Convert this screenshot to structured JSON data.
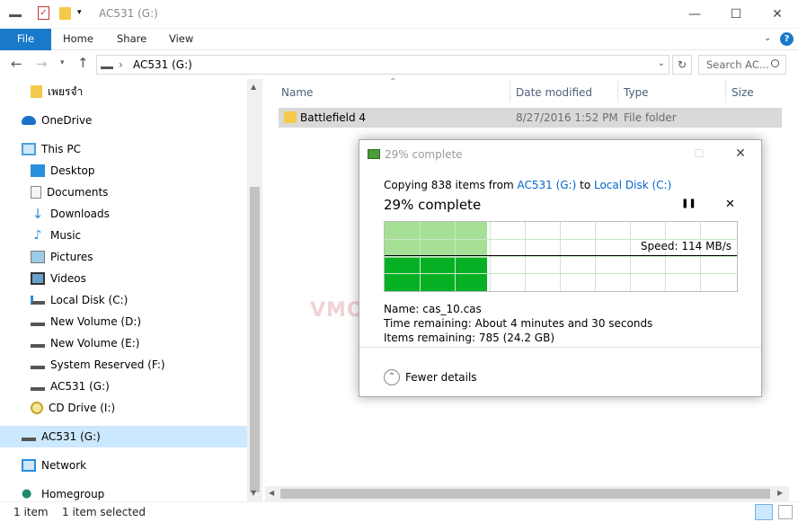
{
  "window": {
    "title": "AC531 (G:)",
    "controls": [
      "—",
      "☐",
      "✕"
    ]
  },
  "ribbon": {
    "tabs": [
      "File",
      "Home",
      "Share",
      "View"
    ]
  },
  "address": {
    "path": "AC531 (G:)",
    "search_placeholder": "Search AC..."
  },
  "nav": {
    "items": [
      {
        "label": "เพยรจำ",
        "icon": "folder-icon"
      },
      {
        "label": "OneDrive",
        "icon": "cloud-icon"
      },
      {
        "label": "This PC",
        "icon": "computer-icon"
      },
      {
        "label": "Desktop",
        "icon": "desktop-icon"
      },
      {
        "label": "Documents",
        "icon": "documents-icon"
      },
      {
        "label": "Downloads",
        "icon": "download-icon"
      },
      {
        "label": "Music",
        "icon": "music-icon"
      },
      {
        "label": "Pictures",
        "icon": "pictures-icon"
      },
      {
        "label": "Videos",
        "icon": "videos-icon"
      },
      {
        "label": "Local Disk (C:)",
        "icon": "drive-icon"
      },
      {
        "label": "New Volume (D:)",
        "icon": "drive-icon"
      },
      {
        "label": "New Volume (E:)",
        "icon": "drive-icon"
      },
      {
        "label": "System Reserved (F:)",
        "icon": "drive-icon"
      },
      {
        "label": "AC531 (G:)",
        "icon": "drive-icon"
      },
      {
        "label": "CD Drive (I:)",
        "icon": "cd-icon"
      },
      {
        "label": "AC531 (G:)",
        "icon": "drive-icon"
      },
      {
        "label": "Network",
        "icon": "network-icon"
      },
      {
        "label": "Homegroup",
        "icon": "homegroup-icon"
      }
    ]
  },
  "columns": {
    "name": "Name",
    "date": "Date modified",
    "type": "Type",
    "size": "Size"
  },
  "files": [
    {
      "name": "Battlefield 4",
      "date": "8/27/2016 1:52 PM",
      "type": "File folder",
      "size": ""
    }
  ],
  "status": {
    "count": "1 item",
    "selected": "1 item selected"
  },
  "dialog": {
    "title": "29% complete",
    "copy_prefix": "Copying 838 items from",
    "source": "AC531 (G:)",
    "to": "to",
    "dest": "Local Disk (C:)",
    "progress_text": "29% complete",
    "progress": 0.29,
    "speed": "Speed: 114 MB/s",
    "name_label": "Name:",
    "name_value": "cas_10.cas",
    "time_label": "Time remaining:",
    "time_value": "About 4 minutes and 30 seconds",
    "items_label": "Items remaining:",
    "items_value": "785 (24.2 GB)",
    "fewer": "Fewer details",
    "pause": "❚❚",
    "stop": "✕"
  },
  "watermark": "VMODTECH.COM",
  "colors": {
    "accent": "#1979ca",
    "progress": "#06b025",
    "link": "#0066cc"
  }
}
